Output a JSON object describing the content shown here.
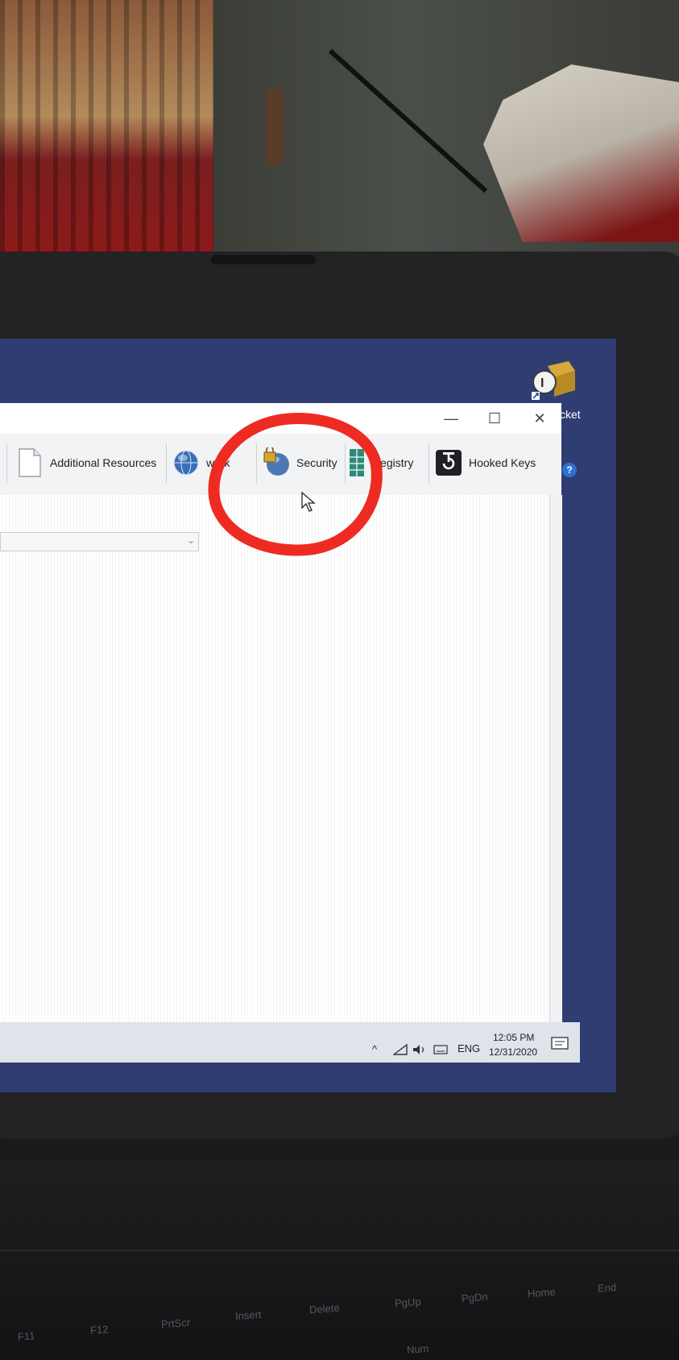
{
  "window": {
    "controls": {
      "minimize": "—",
      "maximize": "☐",
      "close": "✕"
    },
    "tabs": [
      {
        "label": "Additional Resources",
        "icon": "document-icon"
      },
      {
        "label": "work",
        "icon": "globe-network-icon"
      },
      {
        "label": "Security",
        "icon": "globe-lock-icon"
      },
      {
        "label": "Registry",
        "icon": "registry-icon"
      },
      {
        "label": "Hooked Keys",
        "icon": "hook-icon"
      }
    ],
    "dropdown": {
      "value": "",
      "chevron": "⌄"
    },
    "help": "?"
  },
  "desktop": {
    "shortcut_label": "cket"
  },
  "taskbar": {
    "tray": {
      "language": "ENG",
      "chevron": "^"
    },
    "clock": {
      "time": "12:05 PM",
      "date": "12/31/2020"
    }
  },
  "keyboard": {
    "keys": [
      "F11",
      "F12",
      "PrtScr",
      "Insert",
      "Delete",
      "PgUp",
      "PgDn",
      "Home",
      "End",
      "Num"
    ]
  },
  "colors": {
    "annotation": "#ee2b22",
    "desktop": "#2f3d73",
    "window_bg": "#ffffff",
    "tabbar_bg": "#f2f3f5"
  }
}
